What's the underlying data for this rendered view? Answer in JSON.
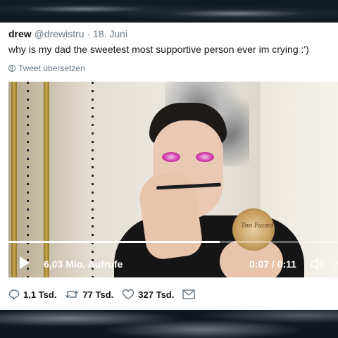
{
  "tweet": {
    "author_name": "drew",
    "author_handle": "@drewistru",
    "separator": "·",
    "date": "18. Juni",
    "text": "why is my dad the sweetest most supportive person ever im crying :')",
    "translate_label": "Tweet übersetzen"
  },
  "video": {
    "views": "6,03 Mio. Aufrufe",
    "time": "0:07 / 0:11",
    "progress_fraction": 0.64,
    "compact_label": "Too Faced"
  },
  "actions": {
    "replies": "1,1 Tsd.",
    "retweets": "77 Tsd.",
    "likes": "327 Tsd."
  },
  "icons": {
    "translate": "globe-icon",
    "play": "play-icon",
    "volume": "volume-icon",
    "fullscreen": "fullscreen-icon",
    "reply": "reply-icon",
    "retweet": "retweet-icon",
    "like": "heart-icon",
    "message": "mail-icon"
  },
  "colors": {
    "secondary_text": "#657786",
    "primary_text": "#14171a"
  }
}
